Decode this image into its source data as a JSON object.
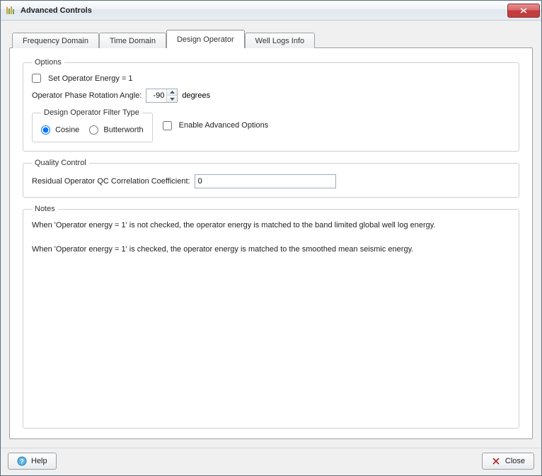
{
  "window": {
    "title": "Advanced Controls"
  },
  "tabs": {
    "freq": "Frequency Domain",
    "time": "Time Domain",
    "design": "Design Operator",
    "logs": "Well Logs Info",
    "active": "design"
  },
  "options": {
    "legend": "Options",
    "set_energy_label": "Set Operator Energy = 1",
    "set_energy_checked": false,
    "phase_label": "Operator Phase Rotation Angle:",
    "phase_value": "-90",
    "phase_units": "degrees",
    "filter_legend": "Design Operator Filter Type",
    "cosine_label": "Cosine",
    "butter_label": "Butterworth",
    "filter_selected": "cosine",
    "enable_adv_label": "Enable Advanced Options",
    "enable_adv_checked": false
  },
  "qc": {
    "legend": "Quality Control",
    "label": "Residual Operator QC Correlation Coefficient:",
    "value": "0"
  },
  "notes": {
    "legend": "Notes",
    "p1": "When 'Operator energy = 1' is not checked, the operator energy is matched to the band limited global well log energy.",
    "p2": "When 'Operator energy = 1' is checked, the operator energy is matched to the smoothed mean seismic energy."
  },
  "footer": {
    "help": "Help",
    "close": "Close"
  }
}
